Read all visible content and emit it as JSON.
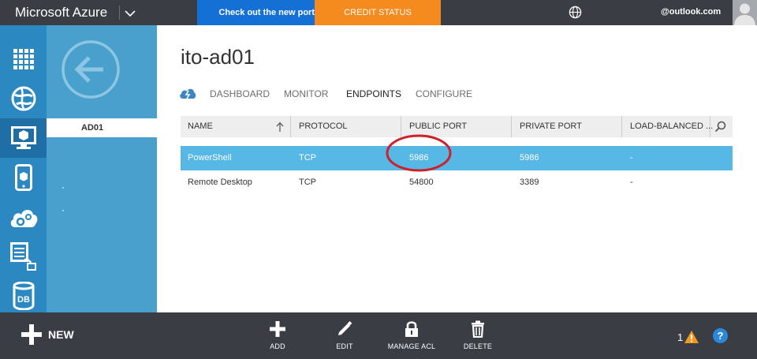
{
  "topbar": {
    "brand": "Microsoft Azure",
    "promo_text": "Check out the new port",
    "credit_status_label": "CREDIT STATUS",
    "account_email": "@outlook.com",
    "colors": {
      "bar": "#3a3d44",
      "promo": "#1570d6",
      "credit": "#f58a1f"
    }
  },
  "leftnav": {
    "items": [
      {
        "icon": "all-items-grid-icon"
      },
      {
        "icon": "web-sites-globe-icon"
      },
      {
        "icon": "virtual-machines-monitor-icon",
        "active": true
      },
      {
        "icon": "mobile-services-icon"
      },
      {
        "icon": "cloud-services-gear-icon"
      },
      {
        "icon": "batch-services-icon"
      },
      {
        "icon": "sql-database-icon",
        "label": "DB"
      }
    ]
  },
  "subnav": {
    "back_icon": "back-arrow-icon",
    "selected_item": "AD01"
  },
  "main": {
    "title": "ito-ad01",
    "tabs": [
      {
        "label": "DASHBOARD"
      },
      {
        "label": "MONITOR"
      },
      {
        "label": "ENDPOINTS",
        "active": true
      },
      {
        "label": "CONFIGURE"
      }
    ],
    "table": {
      "columns": [
        "NAME",
        "PROTOCOL",
        "PUBLIC PORT",
        "PRIVATE PORT",
        "LOAD-BALANCED ..."
      ],
      "sort_icon": "sort-ascending-arrow-icon",
      "search_icon": "search-icon",
      "rows": [
        {
          "name": "PowerShell",
          "protocol": "TCP",
          "public_port": "5986",
          "private_port": "5986",
          "load_balanced": "-",
          "selected": true
        },
        {
          "name": "Remote Desktop",
          "protocol": "TCP",
          "public_port": "54800",
          "private_port": "3389",
          "load_balanced": "-",
          "selected": false
        }
      ],
      "selected_row_color": "#57b7e5",
      "annotation_color": "#d0202a"
    }
  },
  "bottombar": {
    "new_label": "NEW",
    "commands": [
      {
        "label": "ADD",
        "icon": "plus-icon"
      },
      {
        "label": "EDIT",
        "icon": "pencil-icon"
      },
      {
        "label": "MANAGE ACL",
        "icon": "lock-icon"
      },
      {
        "label": "DELETE",
        "icon": "trash-icon"
      }
    ],
    "alert_count": "1",
    "alert_icon": "warning-icon",
    "help_label": "?"
  }
}
